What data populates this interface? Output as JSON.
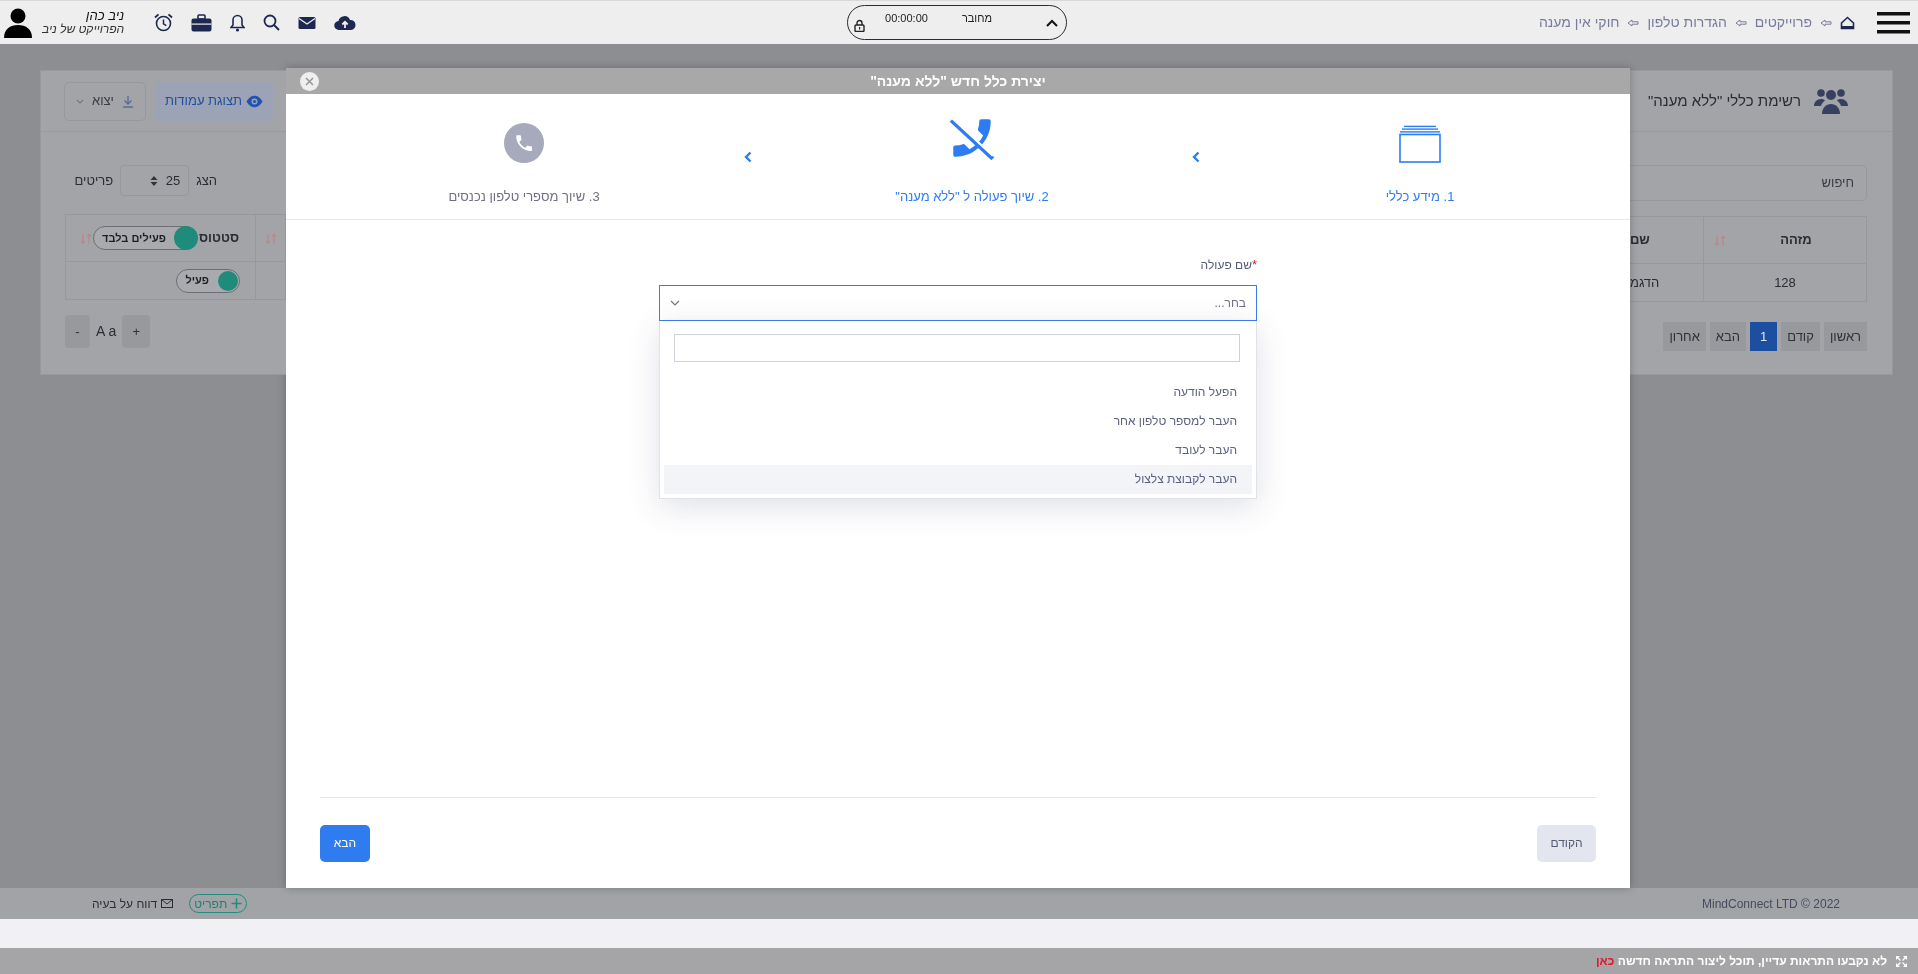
{
  "topbar": {
    "breadcrumbs": [
      "פרוייקטים",
      "הגדרות טלפון",
      "חוקי אין מענה"
    ],
    "connection": {
      "status": "מחובר",
      "timer": "00:00:00"
    },
    "user": {
      "name": "ניב כהן",
      "project": "הפרוייקט של ניב"
    }
  },
  "background": {
    "title": "רשימת כללי \"ללא מענה\"",
    "buttons": [
      "תצוגת עמודות",
      "יצוא"
    ],
    "search": {
      "placeholder": "חיפוש"
    },
    "page_size": {
      "before": "הצג",
      "value": "25",
      "after": "פריטים"
    },
    "columns": [
      {
        "label": "מזהה"
      },
      {
        "label": "שם"
      },
      {
        "label": "סטטוס",
        "filter": {
          "label": "פעילים בלבד",
          "on": true
        }
      }
    ],
    "rows": [
      {
        "id": "128",
        "name": "הדגמ",
        "status": {
          "label": "פעיל",
          "on": true
        }
      }
    ],
    "pagination": [
      {
        "label": "ראשון",
        "selected": false
      },
      {
        "label": "קודם",
        "selected": false
      },
      {
        "label": "1",
        "selected": true
      },
      {
        "label": "הבא",
        "selected": false
      },
      {
        "label": "אחרון",
        "selected": false
      }
    ],
    "font_controls": {
      "increase": "+",
      "label": "A a",
      "decrease": "-"
    }
  },
  "modal": {
    "title": "יצירת כלל חדש \"ללא מענה\"",
    "steps": [
      {
        "label": "1. מידע כללי",
        "reached": true
      },
      {
        "label": "2. שיוך פעולה ל \"ללא מענה\"",
        "reached": true
      },
      {
        "label": "3. שיוך מספרי טלפון נכנסים",
        "reached": false
      }
    ],
    "field": {
      "label": "שם פעולה",
      "required_mark": "*",
      "placeholder": "בחר...",
      "expanded": true,
      "options": [
        {
          "label": "הפעל הודעה",
          "highlighted": false
        },
        {
          "label": "העבר למספר טלפון אחר",
          "highlighted": false
        },
        {
          "label": "העבר לעובד",
          "highlighted": false
        },
        {
          "label": "העבר לקבוצת צלצול",
          "highlighted": true
        }
      ]
    },
    "buttons": {
      "back": "הקודם",
      "next": "הבא"
    }
  },
  "footer": {
    "copyright": "MindConnect LTD © 2022",
    "report": "דווח על בעיה",
    "menu": "תפריט"
  },
  "notification": {
    "text": "לא נקבעו התראות עדיין, תוכל ליצור התראה חדשה",
    "link": "כאן"
  }
}
